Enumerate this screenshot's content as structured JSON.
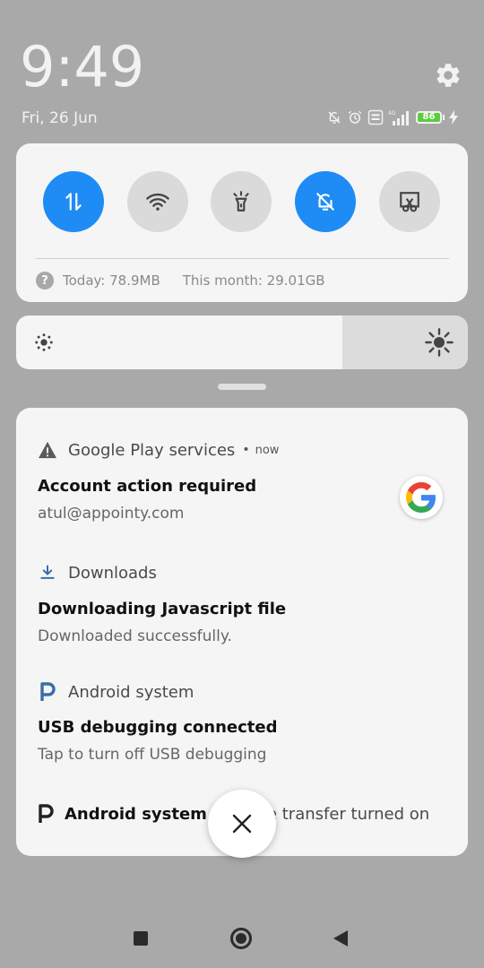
{
  "status": {
    "time": "9:49",
    "date": "Fri, 26 Jun",
    "battery_level": "86",
    "network_type": "4G",
    "volte": "Vo LTE",
    "icons": [
      "bell-off-icon",
      "alarm-icon",
      "volte-icon",
      "signal-icon",
      "battery-icon",
      "charging-icon"
    ]
  },
  "quick_settings": {
    "toggles": [
      {
        "name": "mobile-data",
        "icon": "data-transfer-icon",
        "active": true
      },
      {
        "name": "wifi",
        "icon": "wifi-icon",
        "active": false
      },
      {
        "name": "flashlight",
        "icon": "flashlight-icon",
        "active": false
      },
      {
        "name": "silent",
        "icon": "bell-off-icon",
        "active": true
      },
      {
        "name": "screenshot",
        "icon": "scissors-screenshot-icon",
        "active": false
      }
    ],
    "data_today": "Today: 78.9MB",
    "data_month": "This month: 29.01GB"
  },
  "brightness": {
    "level": 0.72
  },
  "notifications": [
    {
      "app": "Google Play services",
      "time": "now",
      "title": "Account action required",
      "text": "atul@appointy.com"
    },
    {
      "app": "Downloads",
      "title": "Downloading Javascript file",
      "text": "Downloaded successfully."
    },
    {
      "app": "Android system",
      "title": "USB debugging connected",
      "text": "Tap to turn off USB debugging"
    },
    {
      "app": "Android system",
      "text": "USB file transfer turned on"
    }
  ],
  "colors": {
    "accent": "#1e8cf4",
    "background": "#a9a9aa",
    "panel": "#f5f5f5",
    "battery": "#5ccc3e"
  }
}
